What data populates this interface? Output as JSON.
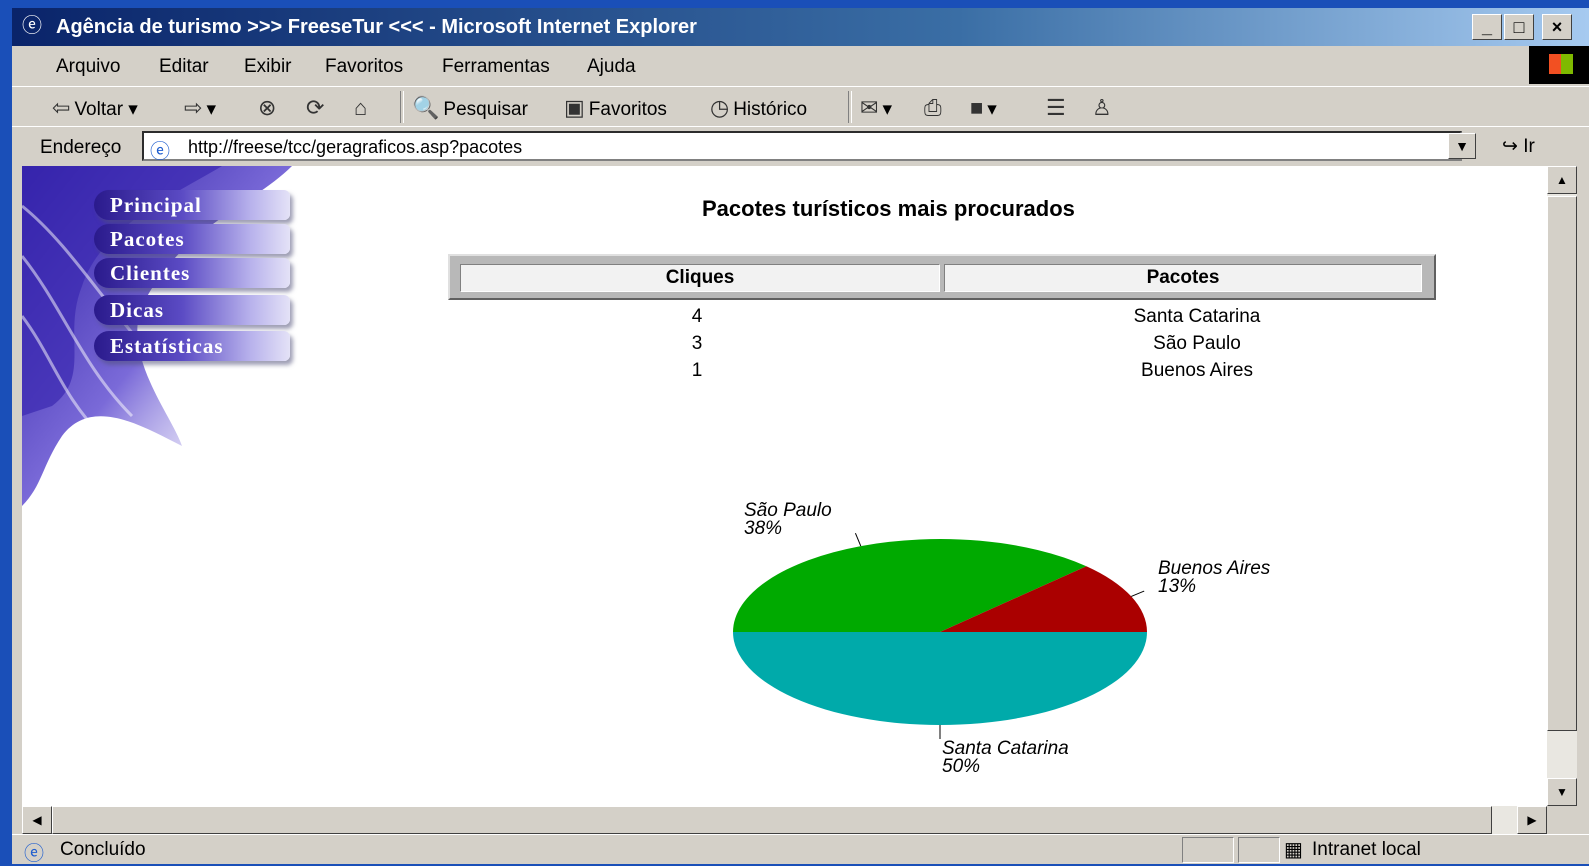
{
  "window": {
    "title": "Agência de turismo >>> FreeseTur <<< - Microsoft Internet Explorer",
    "controls": [
      "_",
      "□",
      "×"
    ]
  },
  "menu": [
    "Arquivo",
    "Editar",
    "Exibir",
    "Favoritos",
    "Ferramentas",
    "Ajuda"
  ],
  "toolbar": {
    "back": "Voltar",
    "search": "Pesquisar",
    "favorites": "Favoritos",
    "history": "Histórico"
  },
  "address": {
    "label": "Endereço",
    "url": "http://freese/tcc/geragraficos.asp?pacotes",
    "go": "Ir"
  },
  "nav": [
    "Principal",
    "Pacotes",
    "Clientes",
    "Dicas",
    "Estatísticas"
  ],
  "page": {
    "title": "Pacotes turísticos mais procurados",
    "table": {
      "headers": [
        "Cliques",
        "Pacotes"
      ],
      "rows": [
        [
          "4",
          "Santa Catarina"
        ],
        [
          "3",
          "São Paulo"
        ],
        [
          "1",
          "Buenos Aires"
        ]
      ]
    }
  },
  "chart_data": {
    "type": "pie",
    "slices": [
      {
        "label": "Santa Catarina",
        "value": 4,
        "percent": "50%",
        "color": "#00aaaa"
      },
      {
        "label": "São Paulo",
        "value": 3,
        "percent": "38%",
        "color": "#00aa00"
      },
      {
        "label": "Buenos Aires",
        "value": 1,
        "percent": "13%",
        "color": "#aa0000"
      }
    ]
  },
  "status": {
    "text": "Concluído",
    "zone": "Intranet local"
  }
}
